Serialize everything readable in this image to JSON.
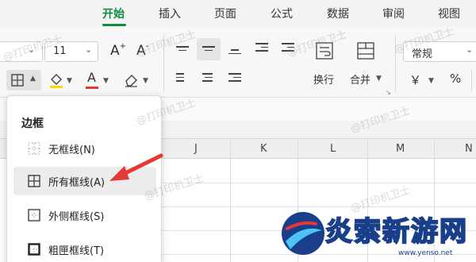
{
  "tabs": [
    {
      "label": "开始",
      "active": true
    },
    {
      "label": "插入"
    },
    {
      "label": "页面"
    },
    {
      "label": "公式"
    },
    {
      "label": "数据"
    },
    {
      "label": "审阅"
    },
    {
      "label": "视图"
    }
  ],
  "font": {
    "size_value": "11",
    "grow_label": "A",
    "shrink_label": "A"
  },
  "alignment": {
    "wrap_label": "换行",
    "merge_label": "合并"
  },
  "number": {
    "format_value": "常规",
    "currency_symbol": "￥",
    "percent_symbol": "%"
  },
  "columns": [
    "J",
    "K",
    "L",
    "M",
    "N"
  ],
  "border_menu": {
    "title": "边框",
    "items": [
      {
        "label": "无框线(N)",
        "icon": "no-border-icon"
      },
      {
        "label": "所有框线(A)",
        "icon": "all-borders-icon",
        "highlighted": true
      },
      {
        "label": "外侧框线(S)",
        "icon": "outside-borders-icon"
      },
      {
        "label": "粗匣框线(T)",
        "icon": "thick-box-border-icon"
      }
    ]
  },
  "watermark_text": "@打印机卫士",
  "logo": {
    "text": "炎索新游网",
    "url": "www.yenso.net"
  },
  "colors": {
    "accent": "#108a3f",
    "arrow": "#e53935",
    "font_color": "#e53935",
    "highlight": "#ffd600"
  }
}
